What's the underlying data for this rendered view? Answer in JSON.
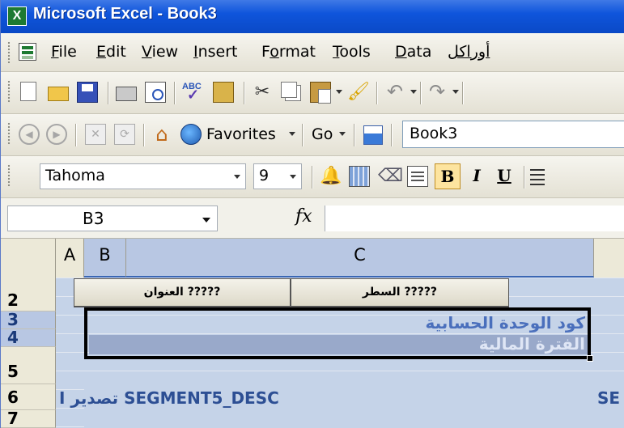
{
  "window": {
    "title": "Microsoft Excel - Book3",
    "app_icon": "excel-icon"
  },
  "menu": {
    "items": [
      {
        "pre": "",
        "u": "F",
        "post": "ile"
      },
      {
        "pre": "",
        "u": "E",
        "post": "dit"
      },
      {
        "pre": "",
        "u": "V",
        "post": "iew"
      },
      {
        "pre": "",
        "u": "I",
        "post": "nsert"
      },
      {
        "pre": "F",
        "u": "o",
        "post": "rmat"
      },
      {
        "pre": "",
        "u": "T",
        "post": "ools"
      },
      {
        "pre": "",
        "u": "D",
        "post": "ata"
      }
    ],
    "arabic_item": "أوراكل"
  },
  "web_toolbar": {
    "favorites": "Favorites",
    "favorites_underlined": "s",
    "go": "Go",
    "go_underlined": "G",
    "address": "Book3"
  },
  "format_toolbar": {
    "font_name": "Tahoma",
    "font_size": "9",
    "bold": "B",
    "italic": "I",
    "underline": "U"
  },
  "formula_bar": {
    "name_box": "B3",
    "fx_label": "fx",
    "formula": ""
  },
  "grid": {
    "columns": [
      {
        "label": "A",
        "selected": false
      },
      {
        "label": "B",
        "selected": false
      },
      {
        "label": "C",
        "selected": false
      }
    ],
    "rows": [
      {
        "label": "2",
        "selected": false
      },
      {
        "label": "3",
        "selected": true
      },
      {
        "label": "4",
        "selected": true
      },
      {
        "label": "5",
        "selected": false
      },
      {
        "label": "6",
        "selected": false
      },
      {
        "label": "7",
        "selected": false
      }
    ],
    "button_title": "العنوان ?????",
    "button_line": "السطر ?????",
    "row3_text": "كود الوحدة الحسابية",
    "row4_text": "الفترة المالية",
    "row6_left": "I تصدير SEGMENT5_DESC",
    "row6_right": "SE"
  },
  "colors": {
    "title_bar": "#0f55dc",
    "selection_band": "#c5d3e8",
    "row4_fill": "#99a9ca",
    "active_button": "#fde49f"
  }
}
